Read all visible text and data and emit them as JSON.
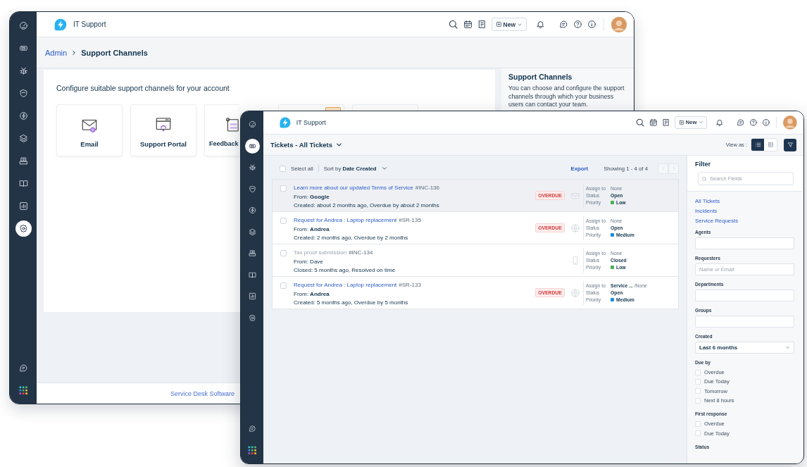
{
  "back_window": {
    "app_title": "IT Support",
    "new_button": "New",
    "sidebar": [
      {
        "selected": false
      },
      {
        "selected": false
      },
      {
        "selected": false
      },
      {
        "selected": false
      },
      {
        "selected": false
      },
      {
        "selected": false
      },
      {
        "selected": false
      },
      {
        "selected": false
      },
      {
        "selected": false
      },
      {
        "selected": true
      }
    ],
    "breadcrumb": {
      "parent": "Admin",
      "current": "Support Channels"
    },
    "intro": "Configure suitable support channels for your account",
    "channels": [
      {
        "kind": "email",
        "label": "Email"
      },
      {
        "kind": "portal",
        "label": "Support Portal"
      },
      {
        "kind": "feedback",
        "label": "Feedback"
      },
      {
        "kind": "covered",
        "flagged": true
      },
      {
        "kind": "covered",
        "flagged": false
      }
    ],
    "info_panel": {
      "title": "Support Channels",
      "text": "You can choose and configure the support channels through which your business users can contact your team."
    },
    "footer_link": "Service Desk Software"
  },
  "front_window": {
    "app_title": "IT Support",
    "new_button": "New",
    "sidebar": [
      {
        "selected": false
      },
      {
        "selected": true
      },
      {
        "selected": false
      },
      {
        "selected": false
      },
      {
        "selected": false
      },
      {
        "selected": false
      },
      {
        "selected": false
      },
      {
        "selected": false
      },
      {
        "selected": false
      },
      {
        "selected": false
      }
    ],
    "view": {
      "prefix": "Tickets -",
      "name": "All Tickets"
    },
    "view_as": {
      "label": "View as :",
      "modes": [
        {
          "kind": "list",
          "selected": true
        },
        {
          "kind": "table",
          "selected": false
        }
      ]
    },
    "toolbar": {
      "select_all": "Select all",
      "select_all_checked": false,
      "sort": "Sort by **Date Created**",
      "export": "Export",
      "showing": "Showing 1 - 4 of 4"
    },
    "tickets": [
      {
        "checked": false,
        "highlighted": true,
        "closed": false,
        "subject": "Learn more about our updated Terms of Service",
        "number": "#INC-136",
        "from": "From: **Google**",
        "timeline": "Created: about 2 months ago, Overdue by about 2 months",
        "badge": "OVERDUE",
        "kind": "mail",
        "assign_label": "Assign to",
        "assign": "None",
        "status_label": "Status",
        "status": "Open",
        "priority_label": "Priority",
        "priority": "Low",
        "color": "#4cae5a"
      },
      {
        "checked": false,
        "highlighted": false,
        "closed": false,
        "subject": "Request for Andrea : Laptop replacement",
        "number": "#SR-135",
        "from": "From: **Andrea**",
        "timeline": "Created: 2 months ago, Overdue by 2 months",
        "badge": "OVERDUE",
        "kind": "portal",
        "assign_label": "Assign to",
        "assign": "None",
        "status_label": "Status",
        "status": "Open",
        "priority_label": "Priority",
        "priority": "Medium",
        "color": "#1e8be0"
      },
      {
        "checked": false,
        "highlighted": false,
        "closed": true,
        "subject": "Tax proof submission",
        "number": "#INC-134",
        "from": "From: Dave",
        "timeline": "Closed: 5 months ago, Resolved on time",
        "kind": "phone",
        "assign_label": "Assign to",
        "assign": "None",
        "status_label": "Status",
        "status": "Closed",
        "priority_label": "Priority",
        "priority": "Low",
        "color": "#4cae5a"
      },
      {
        "checked": false,
        "highlighted": false,
        "closed": false,
        "subject": "Request for Andrea : Laptop replacement",
        "number": "#SR-133",
        "from": "From: **Andrea**",
        "timeline": "Created: 5 months ago, Overdue by 5 months",
        "badge": "OVERDUE",
        "kind": "portal",
        "assign_label": "Assign to",
        "assign": "**Service ...** /None",
        "status_label": "Status",
        "status": "Open",
        "priority_label": "Priority",
        "priority": "Medium",
        "color": "#1e8be0"
      }
    ],
    "filter": {
      "title": "Filter",
      "search_placeholder": "Search Fields",
      "views": [
        {
          "label": "All Tickets"
        },
        {
          "label": "Incidents"
        },
        {
          "label": "Service Requests"
        }
      ],
      "fields": [
        {
          "label": "Agents",
          "kind": "text"
        },
        {
          "label": "Requesters",
          "kind": "text",
          "placeholder": "Name or Email"
        },
        {
          "label": "Departments",
          "kind": "text"
        },
        {
          "label": "Groups",
          "kind": "text"
        },
        {
          "label": "Created",
          "kind": "select",
          "value": "Last 6 months"
        }
      ],
      "checks": [
        {
          "label": "Due by",
          "options": [
            {
              "label": "Overdue",
              "checked": false
            },
            {
              "label": "Due Today",
              "checked": false
            },
            {
              "label": "Tomorrow",
              "checked": false
            },
            {
              "label": "Next 8 hours",
              "checked": false
            }
          ]
        },
        {
          "label": "First response",
          "options": [
            {
              "label": "Overdue",
              "checked": false
            },
            {
              "label": "Due Today",
              "checked": false
            }
          ]
        }
      ],
      "status_label": "Status"
    }
  }
}
